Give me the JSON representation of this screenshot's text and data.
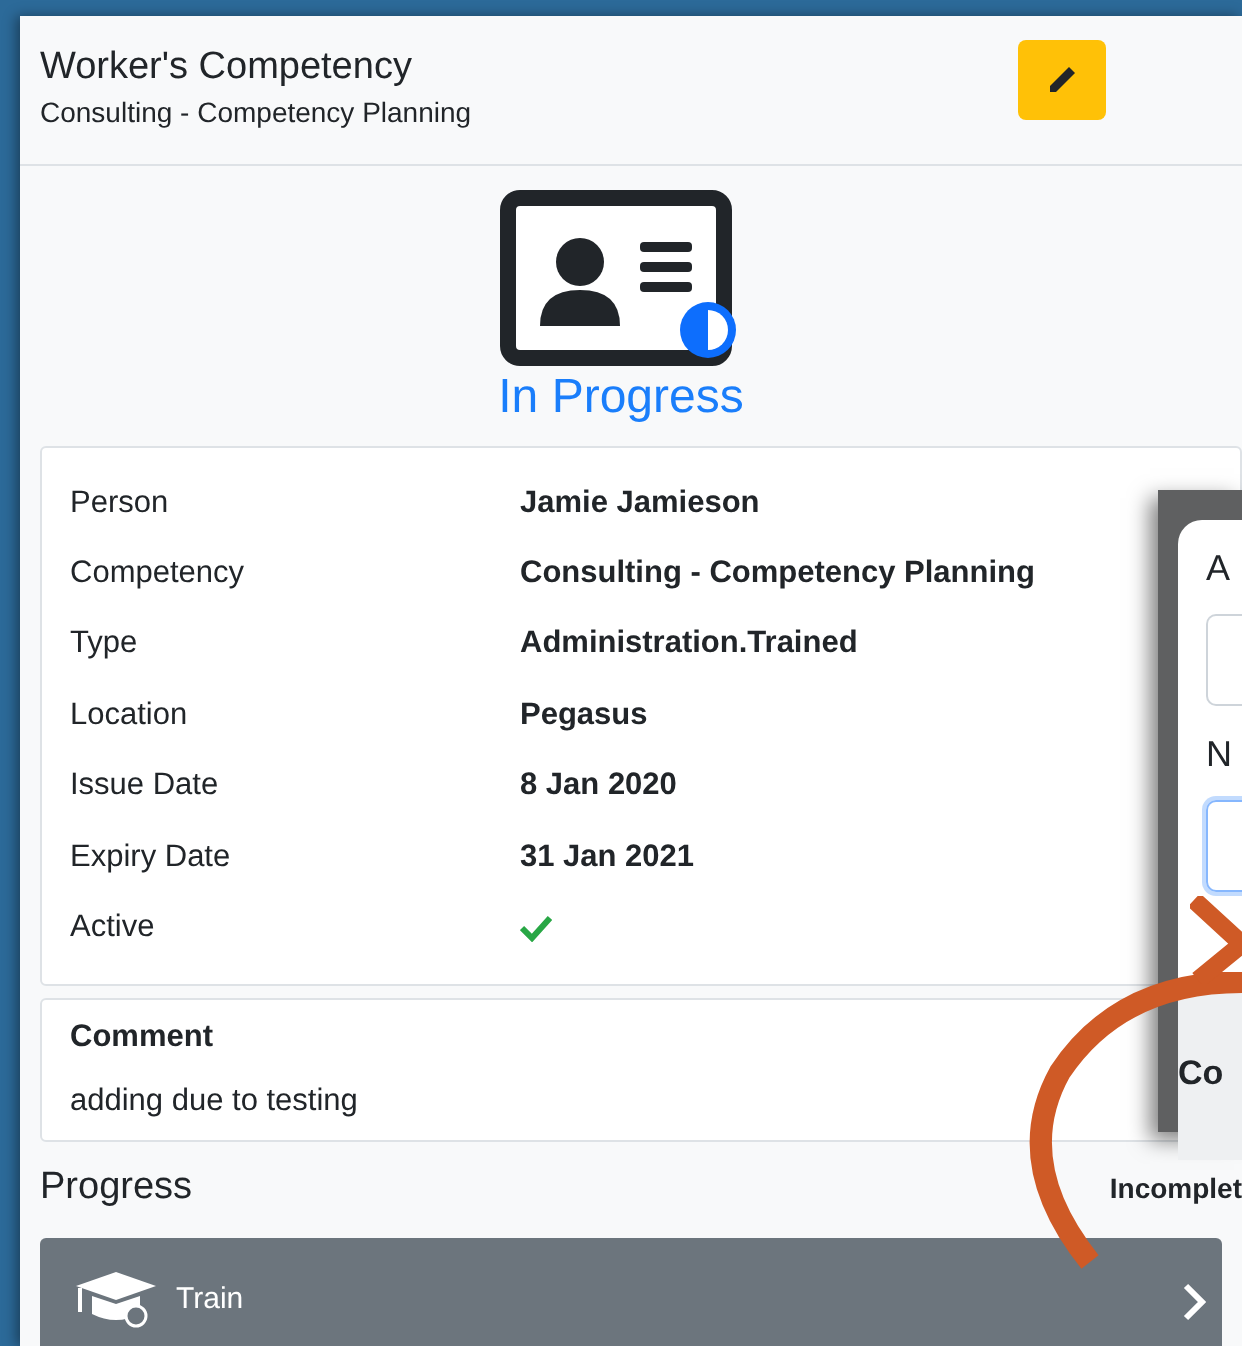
{
  "header": {
    "title": "Worker's Competency",
    "subtitle": "Consulting - Competency Planning"
  },
  "status": {
    "label": "In Progress",
    "kind": "in_progress"
  },
  "details": [
    {
      "label": "Person",
      "value": "Jamie Jamieson",
      "kind": "text"
    },
    {
      "label": "Competency",
      "value": "Consulting - Competency Planning",
      "kind": "text"
    },
    {
      "label": "Type",
      "value": "Administration.Trained",
      "kind": "text"
    },
    {
      "label": "Location",
      "value": "Pegasus",
      "kind": "text"
    },
    {
      "label": "Issue Date",
      "value": "8 Jan 2020",
      "kind": "text"
    },
    {
      "label": "Expiry Date",
      "value": "31 Jan 2021",
      "kind": "text"
    },
    {
      "label": "Active",
      "kind": "check",
      "checked": true
    }
  ],
  "comment": {
    "label": "Comment",
    "text": "adding due to testing"
  },
  "progress": {
    "title": "Progress",
    "state": "Incomplet",
    "steps": [
      {
        "label": "Train"
      }
    ]
  },
  "popup": {
    "fields": [
      {
        "label": "A",
        "focused": false
      },
      {
        "label": "N",
        "focused": true
      }
    ],
    "footer": "Co"
  }
}
